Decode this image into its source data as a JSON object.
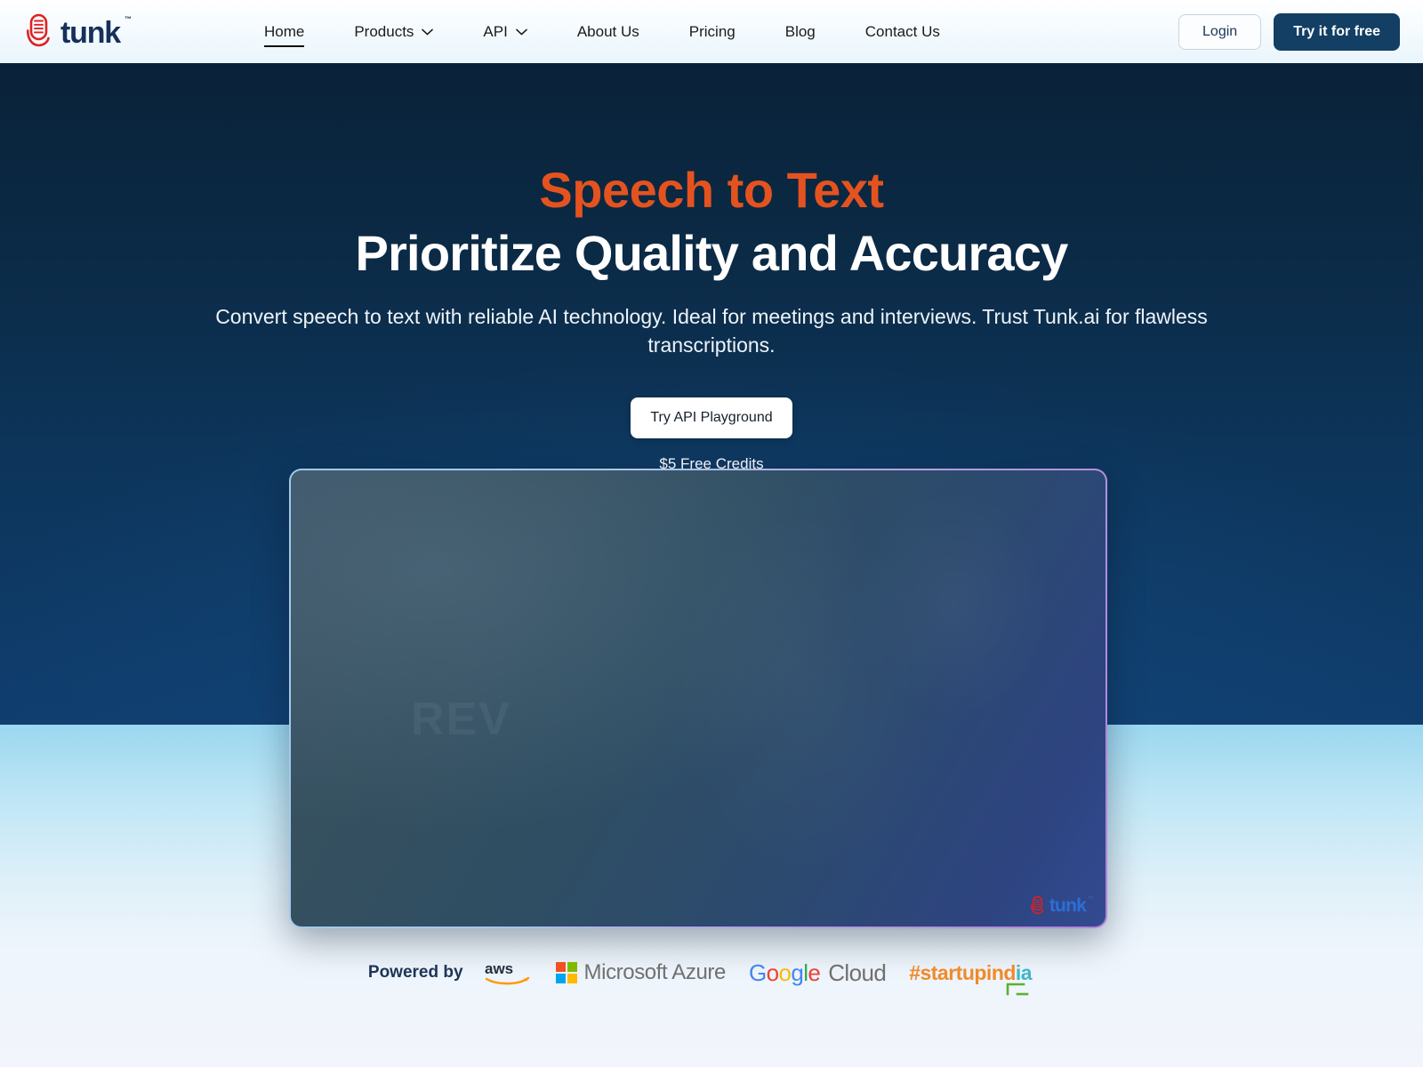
{
  "header": {
    "brand": {
      "name": "tunk",
      "tm": "™",
      "icon": "microphone-logo-icon"
    },
    "nav": [
      {
        "label": "Home",
        "active": true,
        "has_dropdown": false
      },
      {
        "label": "Products",
        "active": false,
        "has_dropdown": true,
        "icon": "chevron-down-icon"
      },
      {
        "label": "API",
        "active": false,
        "has_dropdown": true,
        "icon": "chevron-down-icon"
      },
      {
        "label": "About Us",
        "active": false,
        "has_dropdown": false
      },
      {
        "label": "Pricing",
        "active": false,
        "has_dropdown": false
      },
      {
        "label": "Blog",
        "active": false,
        "has_dropdown": false
      },
      {
        "label": "Contact Us",
        "active": false,
        "has_dropdown": false
      }
    ],
    "login_label": "Login",
    "try_free_label": "Try it for free"
  },
  "hero": {
    "eyebrow_heading": "Speech to Text",
    "main_heading": "Prioritize Quality and Accuracy",
    "subheading": "Convert speech to text with reliable AI technology. Ideal for meetings and interviews. Trust Tunk.ai for flawless transcriptions.",
    "cta_label": "Try API Playground",
    "credits_note": "$5 Free Credits"
  },
  "media": {
    "watermark_brand": "tunk",
    "watermark_tm": "™",
    "background_text": "REV"
  },
  "powered_by": {
    "label": "Powered by",
    "logos": [
      {
        "name": "aws-logo",
        "text": "aws"
      },
      {
        "name": "microsoft-azure-logo",
        "text": "Microsoft Azure"
      },
      {
        "name": "google-cloud-logo",
        "text": "Google Cloud"
      },
      {
        "name": "startup-india-logo",
        "text": "#startupindia"
      }
    ],
    "google_parts": {
      "g1": "G",
      "o1": "o",
      "o2": "o",
      "g2": "g",
      "l": "l",
      "e": "e",
      "cloud": "Cloud"
    },
    "startupindia_parts": {
      "orange": "#startupind",
      "teal": "ia"
    }
  },
  "colors": {
    "brand_orange": "#e4531f",
    "brand_navy": "#16305a",
    "hero_bg_top": "#0a2239",
    "hero_bg_bottom": "#0f3d6e",
    "cta_dark": "#123f63",
    "light_band_top": "#9bd7f0",
    "panel_border_left": "#9ecbe8",
    "panel_border_right": "#b083d8"
  }
}
